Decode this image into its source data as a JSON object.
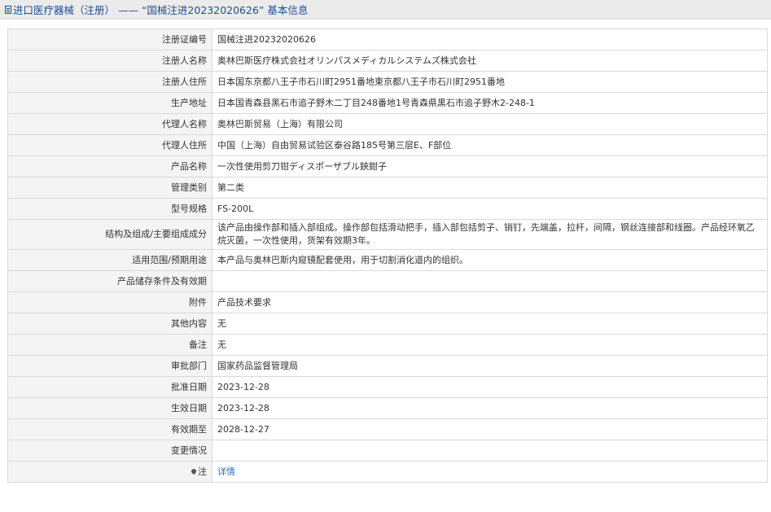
{
  "header": {
    "title": "进口医疗器械（注册） —— “国械注进20232020626” 基本信息"
  },
  "rows": [
    {
      "label": "注册证编号",
      "value": "国械注进20232020626"
    },
    {
      "label": "注册人名称",
      "value": "奥林巴斯医疗株式会社オリンパスメディカルシステムズ株式会社"
    },
    {
      "label": "注册人住所",
      "value": "日本国东京都八王子市石川町2951番地東京都八王子市石川町2951番地"
    },
    {
      "label": "生产地址",
      "value": "日本国青森县黑石市追子野木二丁目248番地1号青森県黒石市追子野木2-248-1"
    },
    {
      "label": "代理人名称",
      "value": "奥林巴斯贸易（上海）有限公司"
    },
    {
      "label": "代理人住所",
      "value": "中国（上海）自由贸易试验区泰谷路185号第三层E、F部位"
    },
    {
      "label": "产品名称",
      "value": "一次性使用剪刀钳ディスポーザブル鋏鉗子"
    },
    {
      "label": "管理类别",
      "value": "第二类"
    },
    {
      "label": "型号规格",
      "value": "FS-200L"
    },
    {
      "label": "结构及组成/主要组成成分",
      "value": "该产品由操作部和插入部组成。操作部包括滑动把手，插入部包括剪子、销钉，先端盖，拉杆，间隔，钢丝连接部和线圈。产品经环氧乙烷灭菌，一次性使用，货架有效期3年。"
    },
    {
      "label": "适用范围/预期用途",
      "value": "本产品与奥林巴斯内窥镜配套使用，用于切割消化道内的组织。"
    },
    {
      "label": "产品储存条件及有效期",
      "value": ""
    },
    {
      "label": "附件",
      "value": "产品技术要求"
    },
    {
      "label": "其他内容",
      "value": "无"
    },
    {
      "label": "备注",
      "value": "无"
    },
    {
      "label": "审批部门",
      "value": "国家药品监督管理局"
    },
    {
      "label": "批准日期",
      "value": "2023-12-28"
    },
    {
      "label": "生效日期",
      "value": "2023-12-28"
    },
    {
      "label": "有效期至",
      "value": "2028-12-27"
    },
    {
      "label": "变更情况",
      "value": ""
    }
  ],
  "note": {
    "label": "注",
    "icon": "pin-icon",
    "link_text": "详情"
  }
}
